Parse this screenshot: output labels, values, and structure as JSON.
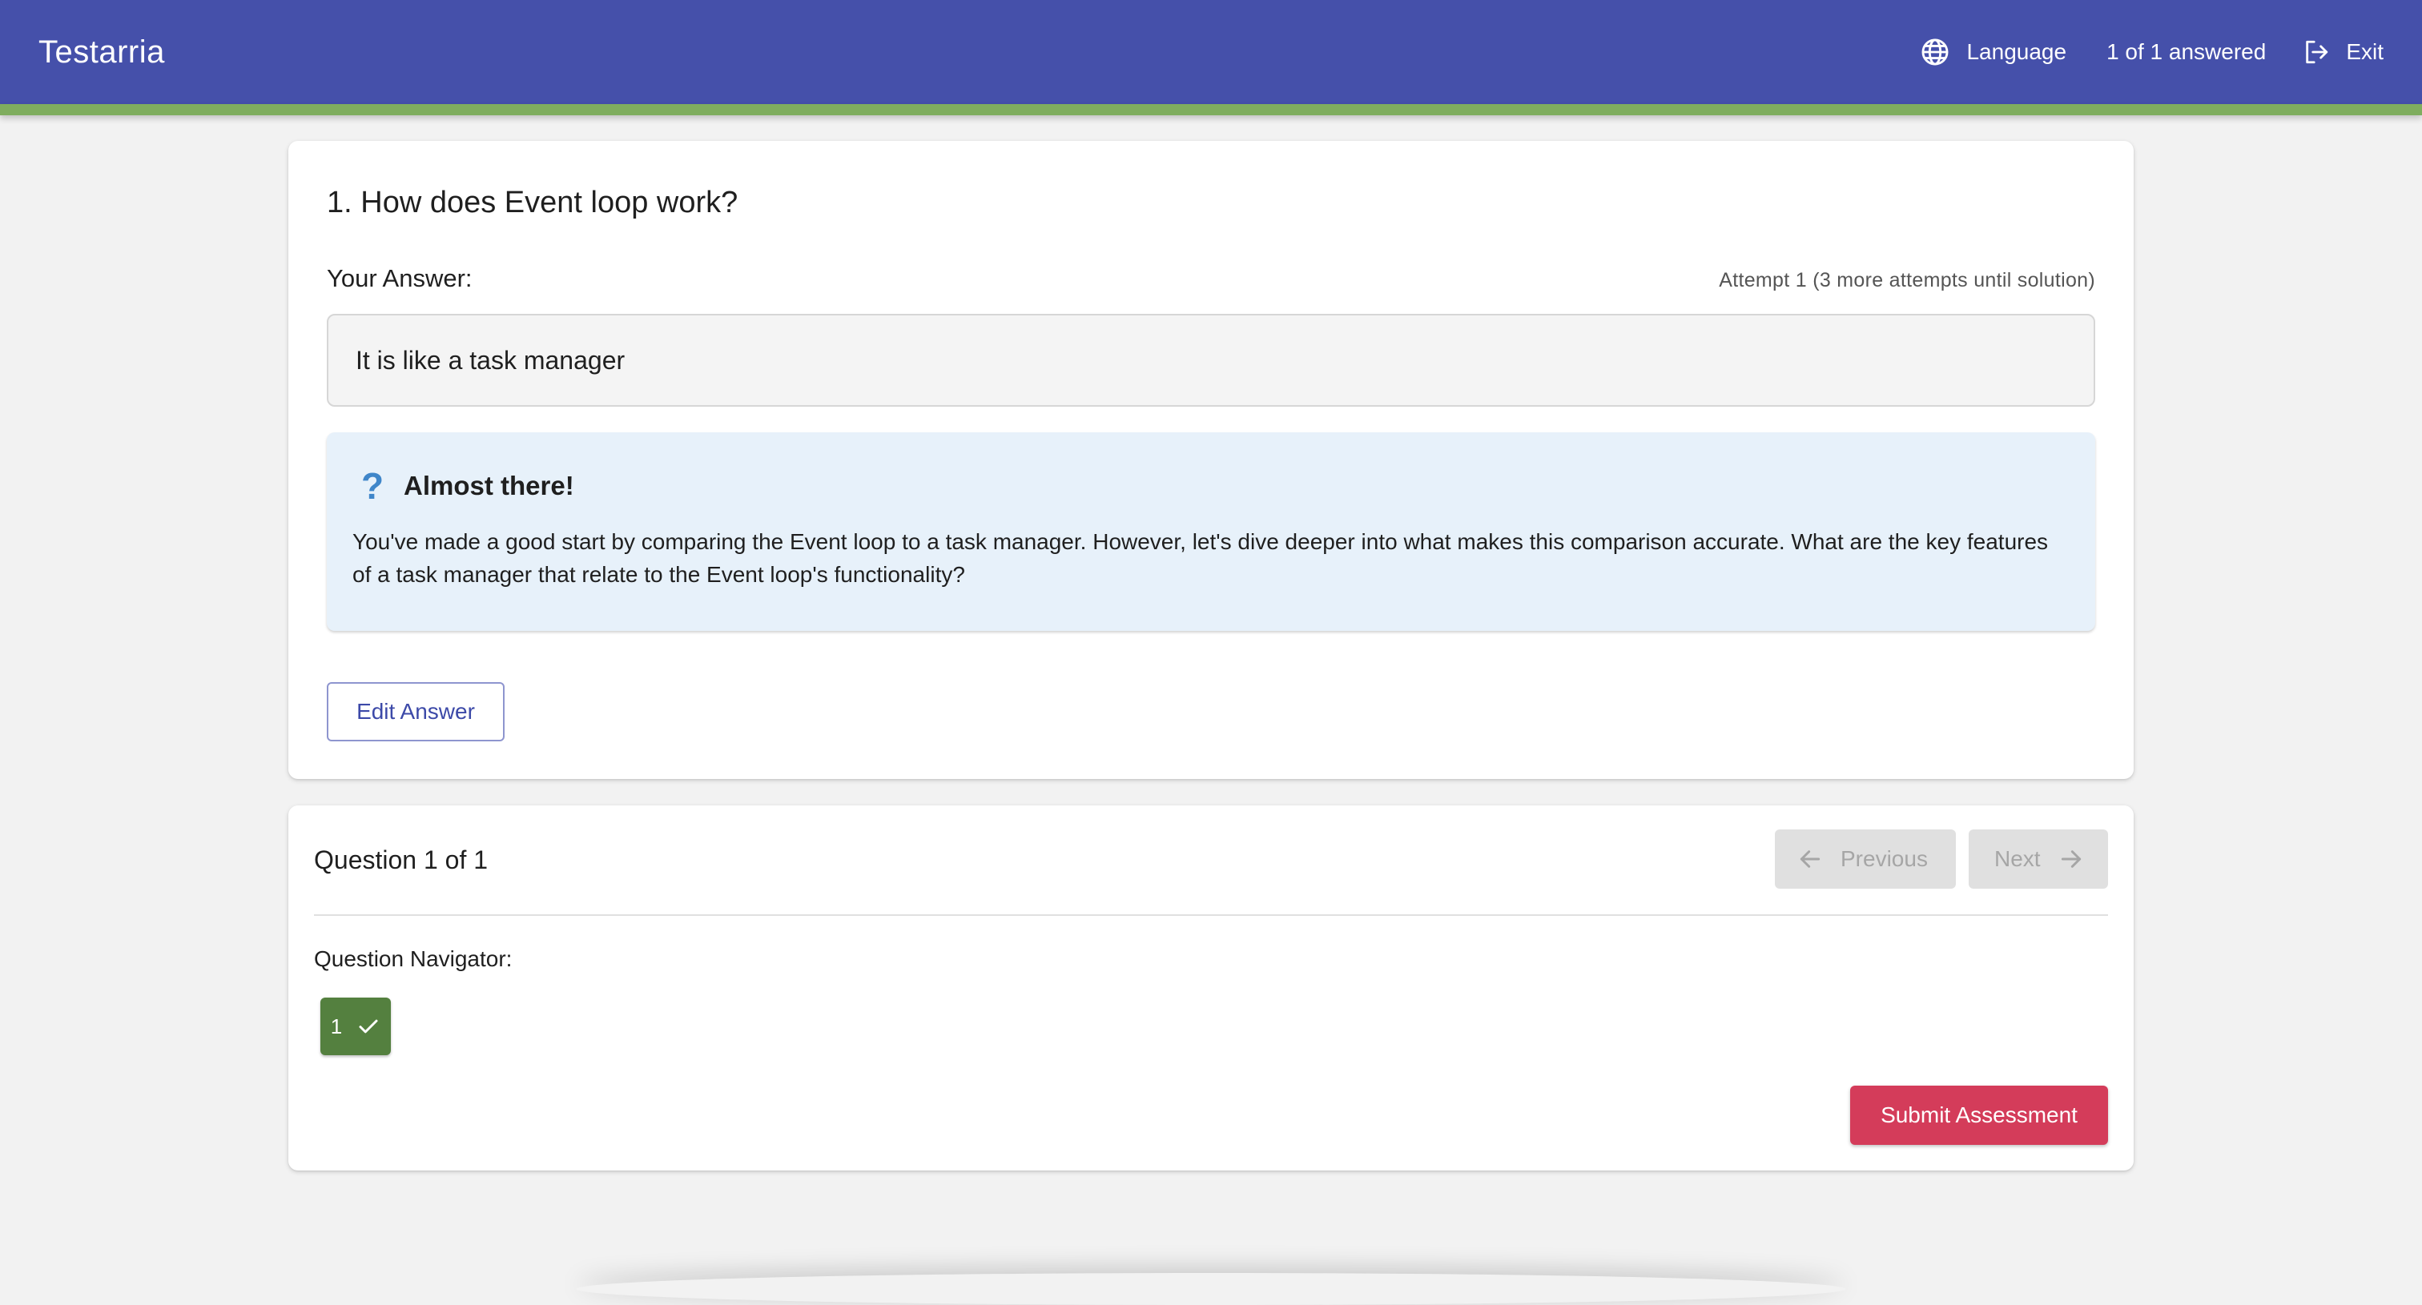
{
  "header": {
    "brand": "Testarria",
    "language_label": "Language",
    "progress_text": "1 of 1 answered",
    "exit_label": "Exit",
    "colors": {
      "bar": "#4550aa",
      "accent": "#7fad5e"
    }
  },
  "question": {
    "title": "1. How does Event loop work?",
    "answer_label": "Your Answer:",
    "attempt_text": "Attempt 1 (3 more attempts until solution)",
    "answer_text": "It is like a task manager"
  },
  "feedback": {
    "icon": "question-mark-icon",
    "title": "Almost there!",
    "text": "You've made a good start by comparing the Event loop to a task manager. However, let's dive deeper into what makes this comparison accurate. What are the key features of a task manager that relate to the Event loop's functionality?"
  },
  "actions": {
    "edit_label": "Edit Answer"
  },
  "navigation": {
    "count_text": "Question 1 of 1",
    "previous_label": "Previous",
    "next_label": "Next",
    "navigator_label": "Question Navigator:",
    "items": [
      {
        "number": "1",
        "status": "answered",
        "icon": "check-icon"
      }
    ],
    "submit_label": "Submit Assessment",
    "colors": {
      "answered": "#54803f",
      "submit": "#d43c5a"
    }
  }
}
